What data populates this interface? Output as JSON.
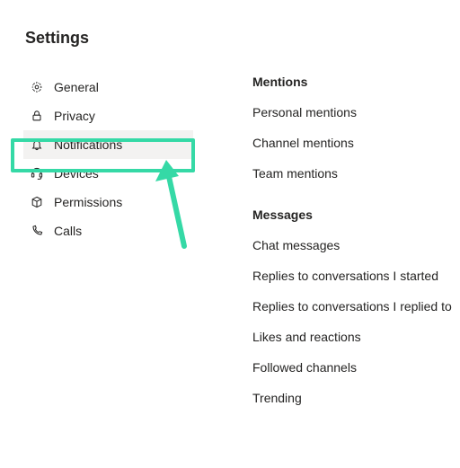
{
  "title": "Settings",
  "sidebar": {
    "items": [
      {
        "label": "General",
        "icon": "gear-icon",
        "selected": false
      },
      {
        "label": "Privacy",
        "icon": "lock-icon",
        "selected": false
      },
      {
        "label": "Notifications",
        "icon": "bell-icon",
        "selected": true
      },
      {
        "label": "Devices",
        "icon": "headset-icon",
        "selected": false
      },
      {
        "label": "Permissions",
        "icon": "package-icon",
        "selected": false
      },
      {
        "label": "Calls",
        "icon": "phone-icon",
        "selected": false
      }
    ]
  },
  "content": {
    "sections": [
      {
        "header": "Mentions",
        "rows": [
          "Personal mentions",
          "Channel mentions",
          "Team mentions"
        ]
      },
      {
        "header": "Messages",
        "rows": [
          "Chat messages",
          "Replies to conversations I started",
          "Replies to conversations I replied to",
          "Likes and reactions",
          "Followed channels",
          "Trending"
        ]
      }
    ]
  },
  "annotation": {
    "arrow_color": "#35d9a6",
    "highlight_color": "#35d9a6"
  }
}
